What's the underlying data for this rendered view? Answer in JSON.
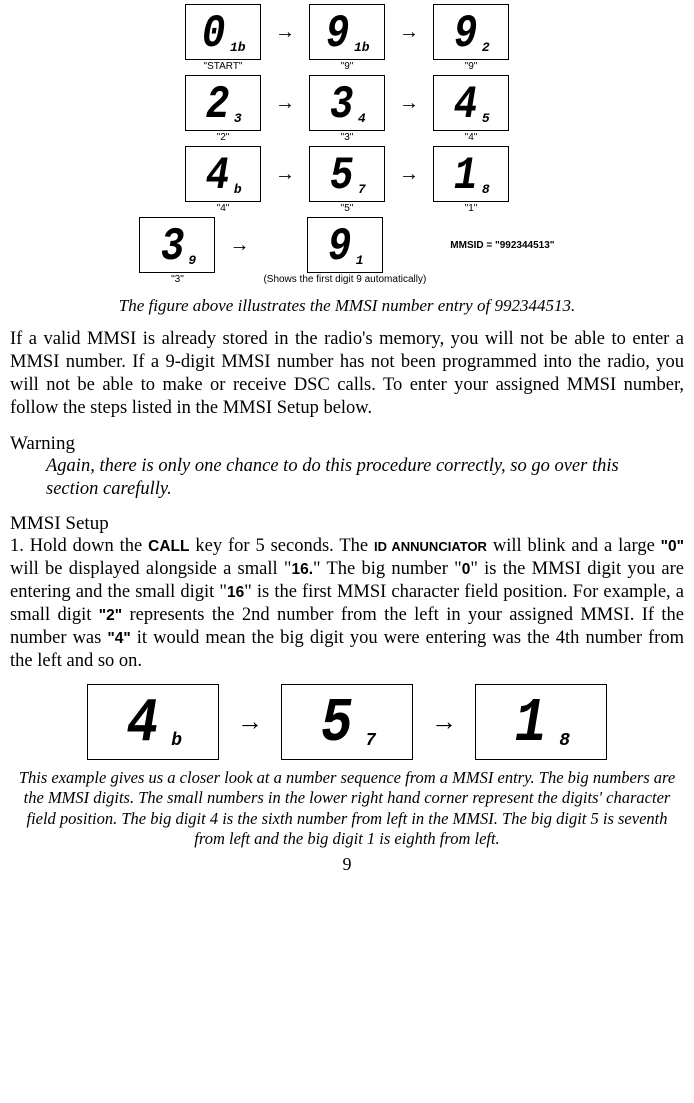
{
  "fig1": {
    "rows": [
      [
        {
          "big": "0",
          "small": "1b",
          "label": "\"START\""
        },
        {
          "big": "9",
          "small": "1b",
          "label": "\"9\""
        },
        {
          "big": "9",
          "small": "2",
          "label": "\"9\""
        }
      ],
      [
        {
          "big": "2",
          "small": "3",
          "label": "\"2\""
        },
        {
          "big": "3",
          "small": "4",
          "label": "\"3\""
        },
        {
          "big": "4",
          "small": "5",
          "label": "\"4\""
        }
      ],
      [
        {
          "big": "4",
          "small": "b",
          "label": "\"4\""
        },
        {
          "big": "5",
          "small": "7",
          "label": "\"5\""
        },
        {
          "big": "1",
          "small": "8",
          "label": "\"1\""
        }
      ],
      [
        {
          "big": "3",
          "small": "9",
          "label": "\"3\""
        },
        {
          "big": "9",
          "small": "1",
          "label": ""
        }
      ]
    ],
    "shows_label": "(Shows the first digit 9 automatically)",
    "mmsid_label": "MMSID = \"992344513\""
  },
  "fig1_caption": "The figure above illustrates the MMSI number entry of 992344513.",
  "para1": "If a valid MMSI is already stored in the radio's memory, you will not be able to enter a MMSI number. If a 9-digit MMSI number has not been programmed into the radio, you will not be able to make or receive DSC calls. To enter your assigned MMSI number, follow the steps listed in the MMSI Setup below.",
  "warning": {
    "head": "Warning",
    "body": "Again, there is only one chance to do this procedure correctly, so go over this section carefully."
  },
  "setup": {
    "head": "MMSI Setup",
    "p1_a": "1. Hold down the ",
    "p1_call": "CALL",
    "p1_b": " key for 5 seconds. The ",
    "p1_id": "ID ANNUNCIATOR",
    "p1_c": " will blink and a large ",
    "p1_q0": "\"0\"",
    "p1_d": " will be displayed alongside a small \"",
    "p1_16a": "16.",
    "p1_e": "\" The big num­ber \"",
    "p1_0": "0",
    "p1_f": "\" is the MMSI digit you are entering and the small digit \"",
    "p1_16b": "16",
    "p1_g": "\" is the first MMSI character field position. For example, a small digit ",
    "p1_q2": "\"2\"",
    "p1_h": " represents the 2nd number from the left in your assigned MMSI. If the number was ",
    "p1_q4": "\"4\"",
    "p1_i": " it would mean the big digit you were entering was the 4th number from the left and so on."
  },
  "fig2": {
    "cells": [
      {
        "big": "4",
        "small": "b"
      },
      {
        "big": "5",
        "small": "7"
      },
      {
        "big": "1",
        "small": "8"
      }
    ]
  },
  "fig2_caption": "This example gives us a closer look at a number sequence from a MMSI entry. The big numbers are the MMSI digits. The small numbers in the lower right hand corner represent the digits' character field position. The big digit 4 is the sixth number from left in the MMSI. The big digit 5 is seventh from left and the big digit 1 is eighth from left.",
  "page_number": "9"
}
